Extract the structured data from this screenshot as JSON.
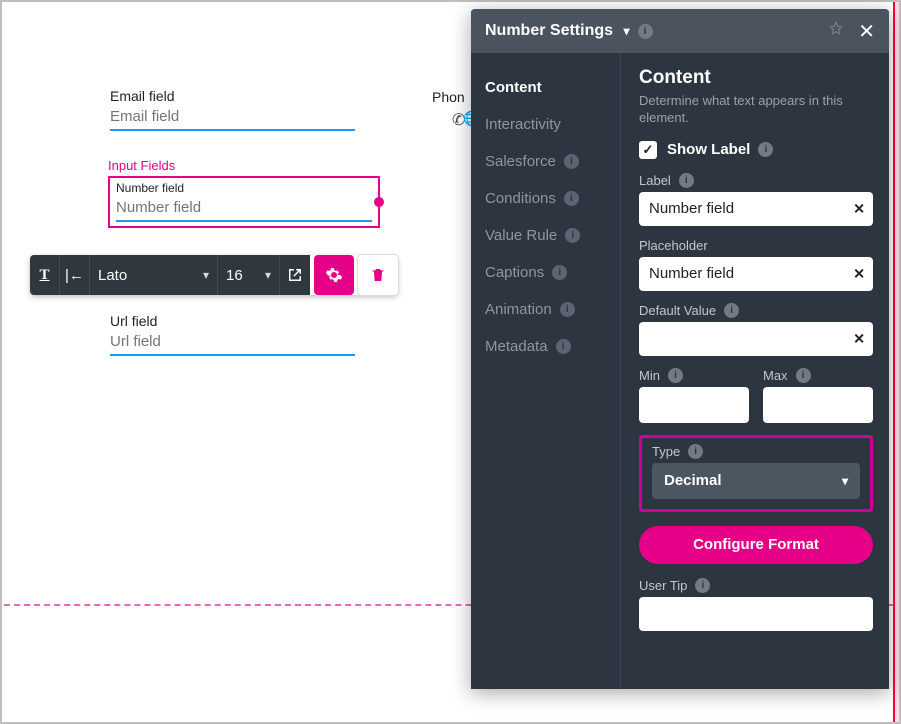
{
  "canvas": {
    "email": {
      "label": "Email field",
      "placeholder": "Email field"
    },
    "phone": {
      "label": "Phon"
    },
    "selection": {
      "badge": "Input Fields",
      "label": "Number field",
      "placeholder": "Number field"
    },
    "url": {
      "label": "Url field",
      "placeholder": "Url field"
    }
  },
  "toolbar": {
    "font": "Lato",
    "fontsize": "16"
  },
  "panel": {
    "title": "Number Settings",
    "sidebar": {
      "items": [
        {
          "label": "Content",
          "active": true
        },
        {
          "label": "Interactivity"
        },
        {
          "label": "Salesforce",
          "info": true
        },
        {
          "label": "Conditions",
          "info": true
        },
        {
          "label": "Value Rule",
          "info": true
        },
        {
          "label": "Captions",
          "info": true
        },
        {
          "label": "Animation",
          "info": true
        },
        {
          "label": "Metadata",
          "info": true
        }
      ]
    },
    "content": {
      "heading": "Content",
      "desc": "Determine what text appears in this element.",
      "showLabel": {
        "label": "Show Label",
        "checked": true
      },
      "label": {
        "title": "Label",
        "value": "Number field"
      },
      "placeholder": {
        "title": "Placeholder",
        "value": "Number field"
      },
      "default": {
        "title": "Default Value",
        "value": ""
      },
      "min": {
        "title": "Min",
        "value": ""
      },
      "max": {
        "title": "Max",
        "value": ""
      },
      "type": {
        "title": "Type",
        "value": "Decimal"
      },
      "configure": "Configure Format",
      "userTip": {
        "title": "User Tip",
        "value": ""
      }
    }
  }
}
